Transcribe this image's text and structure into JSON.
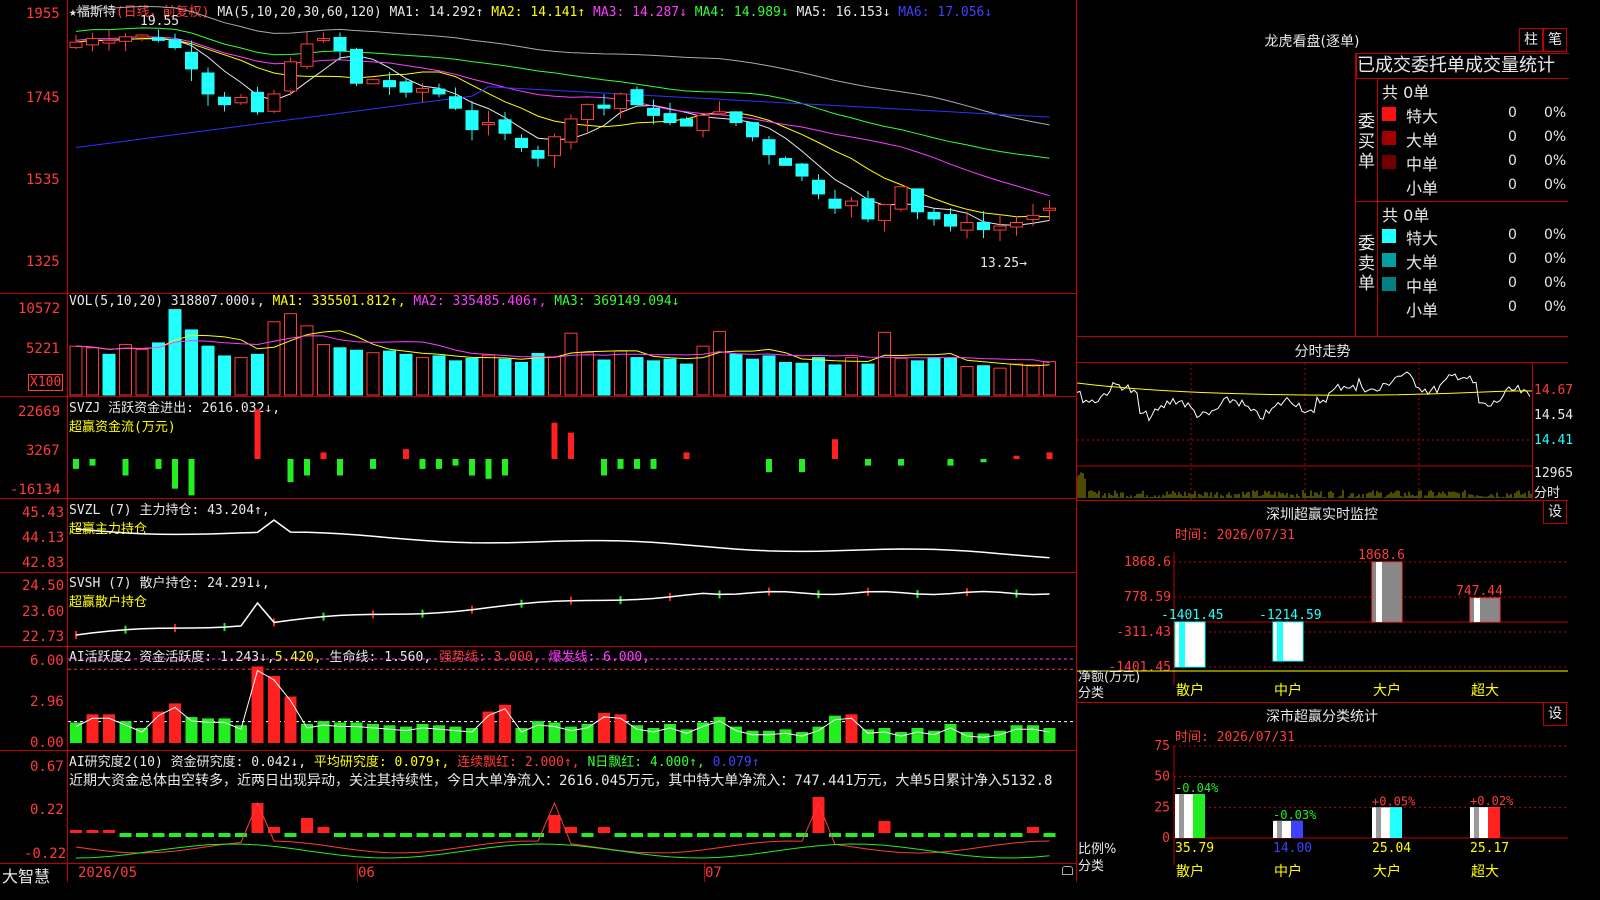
{
  "app": {
    "name": "大智慧"
  },
  "main_chart": {
    "title_star": "★",
    "stock_name": "福斯特",
    "period": "(日线，前复权)",
    "ma_legend": "MA(5,10,20,30,60,120)",
    "ma_values": [
      {
        "label": "MA1: 14.292↑",
        "color": "#e8e8e8"
      },
      {
        "label": "MA2: 14.141↑",
        "color": "#ffff00"
      },
      {
        "label": "MA3: 14.287↓",
        "color": "#ff3cff"
      },
      {
        "label": "MA4: 14.989↓",
        "color": "#33ff33"
      },
      {
        "label": "MA5: 16.153↓",
        "color": "#e8e8e8"
      },
      {
        "label": "MA6: 17.056↓",
        "color": "#4040ff"
      }
    ],
    "y_ticks": [
      "1955",
      "1745",
      "1535",
      "1325"
    ],
    "high_label": "19.55",
    "low_label": "13.25→"
  },
  "volume": {
    "legend": "VOL(5,10,20)",
    "value": "318807.000↓,",
    "ma1": "MA1: 335501.812↑,",
    "ma2": "MA2: 335485.406↑,",
    "ma3": "MA3: 369149.094↓",
    "y_ticks": [
      "10572",
      "5221",
      "X100"
    ]
  },
  "svzj": {
    "legend": "SVZJ  活跃资金进出: 2616.032↓,",
    "sub": "超赢资金流(万元)",
    "y_ticks": [
      "22669",
      "3267",
      "-16134"
    ]
  },
  "svzl": {
    "legend": "SVZL (7) 主力持仓: 43.204↑,",
    "sub": "超赢主力持仓",
    "y_ticks": [
      "45.43",
      "44.13",
      "42.83"
    ]
  },
  "svsh": {
    "legend": "SVSH (7) 散户持仓: 24.291↓,",
    "sub": "超赢散户持仓",
    "y_ticks": [
      "24.50",
      "23.60",
      "22.73"
    ]
  },
  "ai_active": {
    "legend_a": "AI活跃度2 资金活跃度: 1.243↓,",
    "legend_b": "5.420,",
    "legend_c": "生命线: 1.560,",
    "legend_d": "强势线: 3.000,",
    "legend_e": "爆发线: 6.000,",
    "y_ticks": [
      "6.00",
      "2.96",
      "0.00"
    ]
  },
  "ai_research": {
    "legend_a": "AI研究度2(10) 资金研究度: 0.042↓,",
    "legend_b": "平均研究度: 0.079↑,",
    "legend_c": "连续飘红: 2.000↑,",
    "legend_d": "N日飘红: 4.000↑,",
    "legend_e": "0.079↑",
    "commentary": "近期大资金总体由空转多，近两日出现异动，关注其持续性，今日大单净流入：2616.045万元，其中特大单净流入：747.441万元，大单5日累计净入5132.8",
    "y_ticks": [
      "0.67",
      "0.22",
      "-0.22"
    ]
  },
  "x_axis": [
    "2026/05",
    "06",
    "07"
  ],
  "dragon_panel": {
    "title": "龙虎看盘(逐单)",
    "btn_bar": "柱",
    "btn_pen": "笔",
    "tabs_label": "已成交委托单成交量统计",
    "buy_side": {
      "label": "委买单",
      "total": "共 0单",
      "rows": [
        {
          "name": "特大",
          "n": "0",
          "p": "0%",
          "color": "#ff1010"
        },
        {
          "name": "大单",
          "n": "0",
          "p": "0%",
          "color": "#a00000"
        },
        {
          "name": "中单",
          "n": "0",
          "p": "0%",
          "color": "#700000"
        },
        {
          "name": "小单",
          "n": "0",
          "p": "0%",
          "color": "#000000"
        }
      ]
    },
    "sell_side": {
      "label": "委卖单",
      "total": "共 0单",
      "rows": [
        {
          "name": "特大",
          "n": "0",
          "p": "0%",
          "color": "#22ffff"
        },
        {
          "name": "大单",
          "n": "0",
          "p": "0%",
          "color": "#00a0a0"
        },
        {
          "name": "中单",
          "n": "0",
          "p": "0%",
          "color": "#008080"
        },
        {
          "name": "小单",
          "n": "0",
          "p": "0%",
          "color": "#000000"
        }
      ]
    }
  },
  "intraday": {
    "title": "分时走势",
    "price_ticks": [
      "14.67",
      "14.54",
      "14.41"
    ],
    "vol_tick": "12965",
    "vol_label": "分时"
  },
  "realtime_monitor": {
    "title": "深圳超赢实时监控",
    "btn": "设",
    "time_label": "时间: 2026/07/31",
    "y_ticks": [
      "1868.6",
      "778.59",
      "-311.43",
      "-1401.45"
    ],
    "y_axis_label": "净额(万元)",
    "x_axis_label": "分类",
    "chart_data": {
      "type": "bar",
      "categories": [
        "散户",
        "中户",
        "大户",
        "超大"
      ],
      "values": [
        -1401.45,
        -1214.59,
        1868.6,
        747.44
      ],
      "value_labels": [
        "-1401.45",
        "-1214.59",
        "1868.6",
        "747.44"
      ],
      "ylim": [
        -1401.45,
        1868.6
      ]
    }
  },
  "class_stats": {
    "title": "深市超赢分类统计",
    "btn": "设",
    "time_label": "时间: 2026/07/31",
    "y_ticks": [
      "75",
      "50",
      "25",
      "0"
    ],
    "y_axis_label": "比例%",
    "x_axis_label": "分类",
    "chart_data": {
      "type": "bar",
      "categories": [
        "散户",
        "中户",
        "大户",
        "超大"
      ],
      "values": [
        35.79,
        14.0,
        25.04,
        25.17
      ],
      "value_labels": [
        "35.79",
        "14.00",
        "25.04",
        "25.17"
      ],
      "change_labels": [
        "-0.04%",
        "-0.03%",
        "+0.05%",
        "+0.02%"
      ],
      "ylim": [
        0,
        75
      ]
    }
  }
}
